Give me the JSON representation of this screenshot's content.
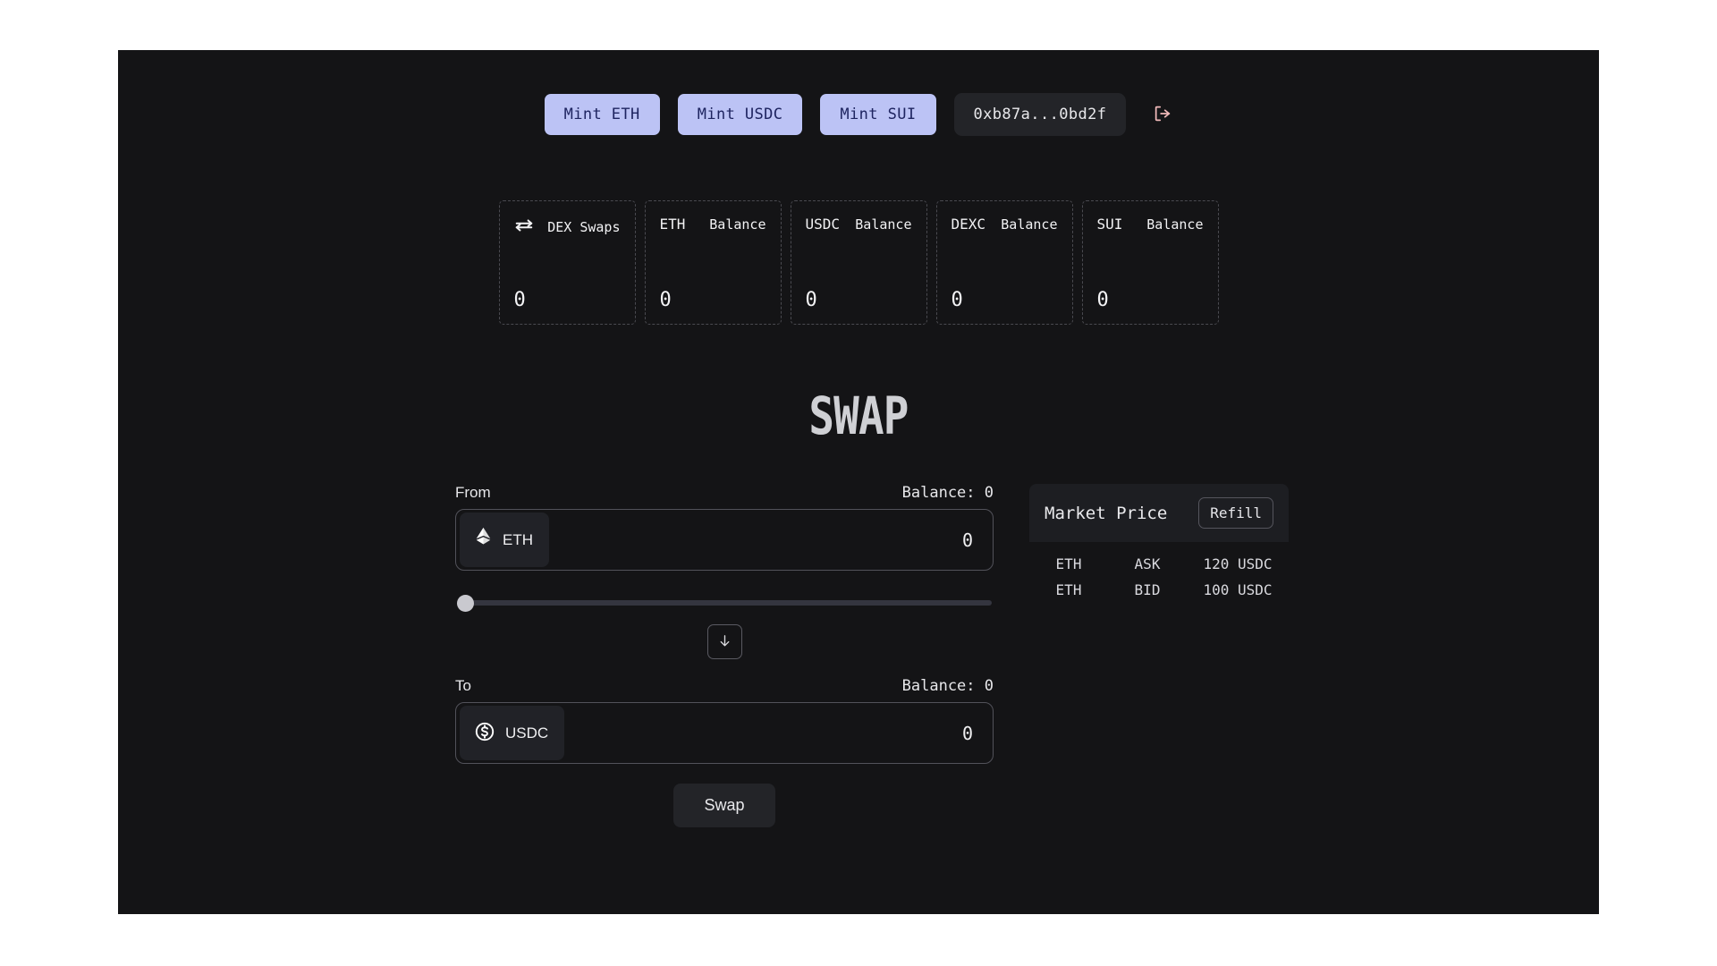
{
  "topbar": {
    "mint_buttons": [
      {
        "label": "Mint ETH",
        "name": "mint-eth-button"
      },
      {
        "label": "Mint USDC",
        "name": "mint-usdc-button"
      },
      {
        "label": "Mint SUI",
        "name": "mint-sui-button"
      }
    ],
    "wallet_address": "0xb87a...0bd2f",
    "logout_icon": "logout-icon",
    "accent_button_bg": "#bcc3f5",
    "logout_icon_color": "#f0b9b9"
  },
  "stats": [
    {
      "title": "DEX Swaps",
      "sub": "",
      "value": "0",
      "icon": "swap-arrows-icon"
    },
    {
      "title": "ETH",
      "sub": "Balance",
      "value": "0",
      "icon": ""
    },
    {
      "title": "USDC",
      "sub": "Balance",
      "value": "0",
      "icon": ""
    },
    {
      "title": "DEXC",
      "sub": "Balance",
      "value": "0",
      "icon": ""
    },
    {
      "title": "SUI",
      "sub": "Balance",
      "value": "0",
      "icon": ""
    }
  ],
  "page_title": "SWAP",
  "swap": {
    "from": {
      "label": "From",
      "balance_label": "Balance: 0",
      "token": "ETH",
      "token_icon": "ethereum-icon",
      "amount": "0",
      "amount_placeholder": "0"
    },
    "slider": {
      "value": "0",
      "min": "0",
      "max": "100"
    },
    "direction_icon": "arrow-down-icon",
    "to": {
      "label": "To",
      "balance_label": "Balance: 0",
      "token": "USDC",
      "token_icon": "dollar-circle-icon",
      "amount": "0",
      "amount_placeholder": "0"
    },
    "action_label": "Swap"
  },
  "market": {
    "title": "Market Price",
    "refill_label": "Refill",
    "rows": [
      {
        "pair": "ETH",
        "side": "ASK",
        "price": "120 USDC"
      },
      {
        "pair": "ETH",
        "side": "BID",
        "price": "100 USDC"
      }
    ]
  }
}
